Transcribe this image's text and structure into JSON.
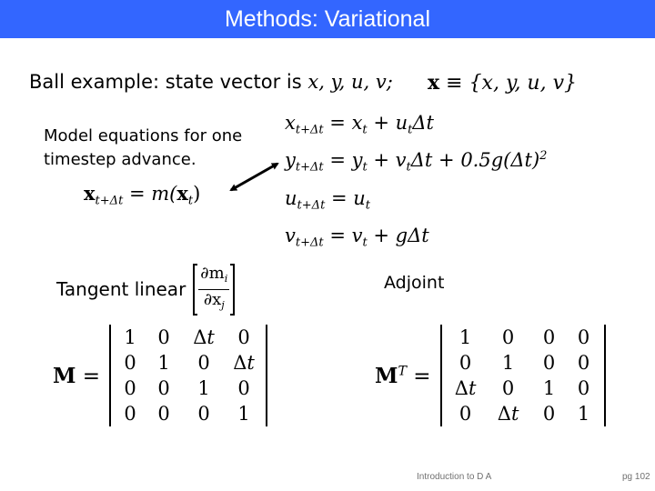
{
  "title": "Methods: Variational",
  "state_line": {
    "text": "Ball example: state vector is ",
    "vars": "x, y, u, v;"
  },
  "state_definition": {
    "bold_symbol": "x",
    "equiv": " ≡ ",
    "set": "{x, y, u, v}"
  },
  "model": {
    "description_line1": "Model equations for one",
    "description_line2": "timestep advance.",
    "equation": {
      "lhs_symbol": "x",
      "lhs_sub": "t+Δt",
      "eq": " = ",
      "func": "m(",
      "arg_symbol": "x",
      "arg_sub": "t",
      "close": ")"
    }
  },
  "equations": [
    {
      "lhs": "x",
      "lhs_sub": "t+Δt",
      "rhs_a": "x",
      "rhs_a_sub": "t",
      "rhs_b": " + u",
      "rhs_b_sub": "t",
      "rhs_c": "Δt",
      "sup": ""
    },
    {
      "lhs": "y",
      "lhs_sub": "t+Δt",
      "rhs_a": "y",
      "rhs_a_sub": "t",
      "rhs_b": " + v",
      "rhs_b_sub": "t",
      "rhs_c": "Δt + 0.5g(Δt)",
      "sup": "2"
    },
    {
      "lhs": "u",
      "lhs_sub": "t+Δt",
      "rhs_a": "u",
      "rhs_a_sub": "t",
      "rhs_b": "",
      "rhs_b_sub": "",
      "rhs_c": "",
      "sup": ""
    },
    {
      "lhs": "v",
      "lhs_sub": "t+Δt",
      "rhs_a": "v",
      "rhs_a_sub": "t",
      "rhs_b": " + gΔt",
      "rhs_b_sub": "",
      "rhs_c": "",
      "sup": ""
    }
  ],
  "tangent_linear": {
    "label": "Tangent linear ",
    "num": "∂m",
    "num_sub": "i",
    "den": "∂x",
    "den_sub": "j"
  },
  "adjoint": {
    "label": "Adjoint"
  },
  "matrix_M": {
    "label": "M",
    "sup": "",
    "eq": " =",
    "rows": [
      [
        "1",
        "0",
        "Δt",
        "0"
      ],
      [
        "0",
        "1",
        "0",
        "Δt"
      ],
      [
        "0",
        "0",
        "1",
        "0"
      ],
      [
        "0",
        "0",
        "0",
        "1"
      ]
    ]
  },
  "matrix_MT": {
    "label": "M",
    "sup": "T",
    "eq": " =",
    "rows": [
      [
        "1",
        "0",
        "0",
        "0"
      ],
      [
        "0",
        "1",
        "0",
        "0"
      ],
      [
        "Δt",
        "0",
        "1",
        "0"
      ],
      [
        "0",
        "Δt",
        "0",
        "1"
      ]
    ]
  },
  "footer": {
    "title": "Introduction to D A",
    "page": "pg 102"
  },
  "colors": {
    "title_bar": "#3366FF",
    "title_text": "#FFFFFF",
    "footer_text": "#707070"
  }
}
